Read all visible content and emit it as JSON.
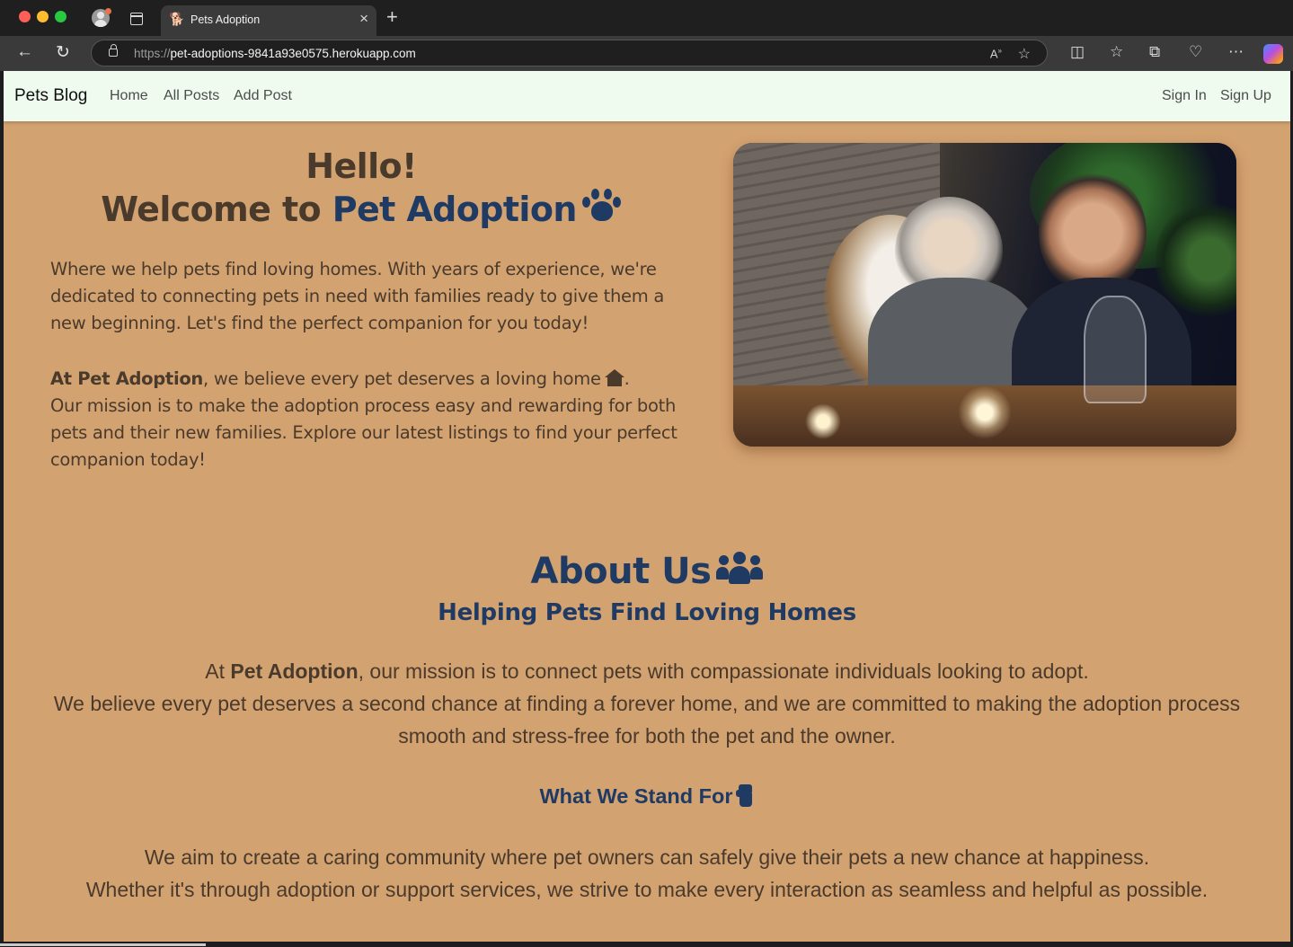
{
  "browser": {
    "tab_title": "Pets Adoption",
    "url_protocol": "https://",
    "url_host": "pet-adoptions-9841a93e0575.herokuapp.com",
    "icons": [
      "back-icon",
      "reload-icon",
      "lock-icon",
      "read-aloud-icon",
      "favorite-star-icon",
      "split-screen-icon",
      "favorites-icon",
      "collections-icon",
      "performance-icon",
      "more-icon",
      "copilot-icon"
    ]
  },
  "navbar": {
    "brand": "Pets Blog",
    "links": [
      "Home",
      "All Posts",
      "Add Post"
    ],
    "auth_links": [
      "Sign In",
      "Sign Up"
    ],
    "background": "#eefbee"
  },
  "hero": {
    "greeting": "Hello!",
    "welcome_prefix": "Welcome to",
    "welcome_brand": "Pet Adoption",
    "intro": "Where we help pets find loving homes. With years of experience, we're dedicated to connecting pets in need with families ready to give them a new beginning. Let's find the perfect companion for you today!",
    "belief_brand": "At Pet Adoption",
    "belief_text": ", we believe every pet deserves a loving home",
    "belief_end": ".",
    "mission": "Our mission is to make the adoption process easy and rewarding for both pets and their new families. Explore our latest listings to find your perfect companion today!"
  },
  "about": {
    "title": "About Us",
    "subtitle": "Helping Pets Find Loving Homes",
    "line1_prefix": "At ",
    "line1_brand": "Pet Adoption",
    "line1_suffix": ", our mission is to connect pets with compassionate individuals looking to adopt.",
    "line2": "We believe every pet deserves a second chance at finding a forever home, and we are committed to making the adoption process smooth and stress-free for both the pet and the owner.",
    "stand_title": "What We Stand For",
    "stand_line1": "We aim to create a caring community where pet owners can safely give their pets a new chance at happiness.",
    "stand_line2": "Whether it's through adoption or support services, we strive to make every interaction as seamless and helpful as possible."
  },
  "colors": {
    "page_background": "#d3a271",
    "accent": "#1f3a63",
    "text": "#4a3a2c"
  }
}
